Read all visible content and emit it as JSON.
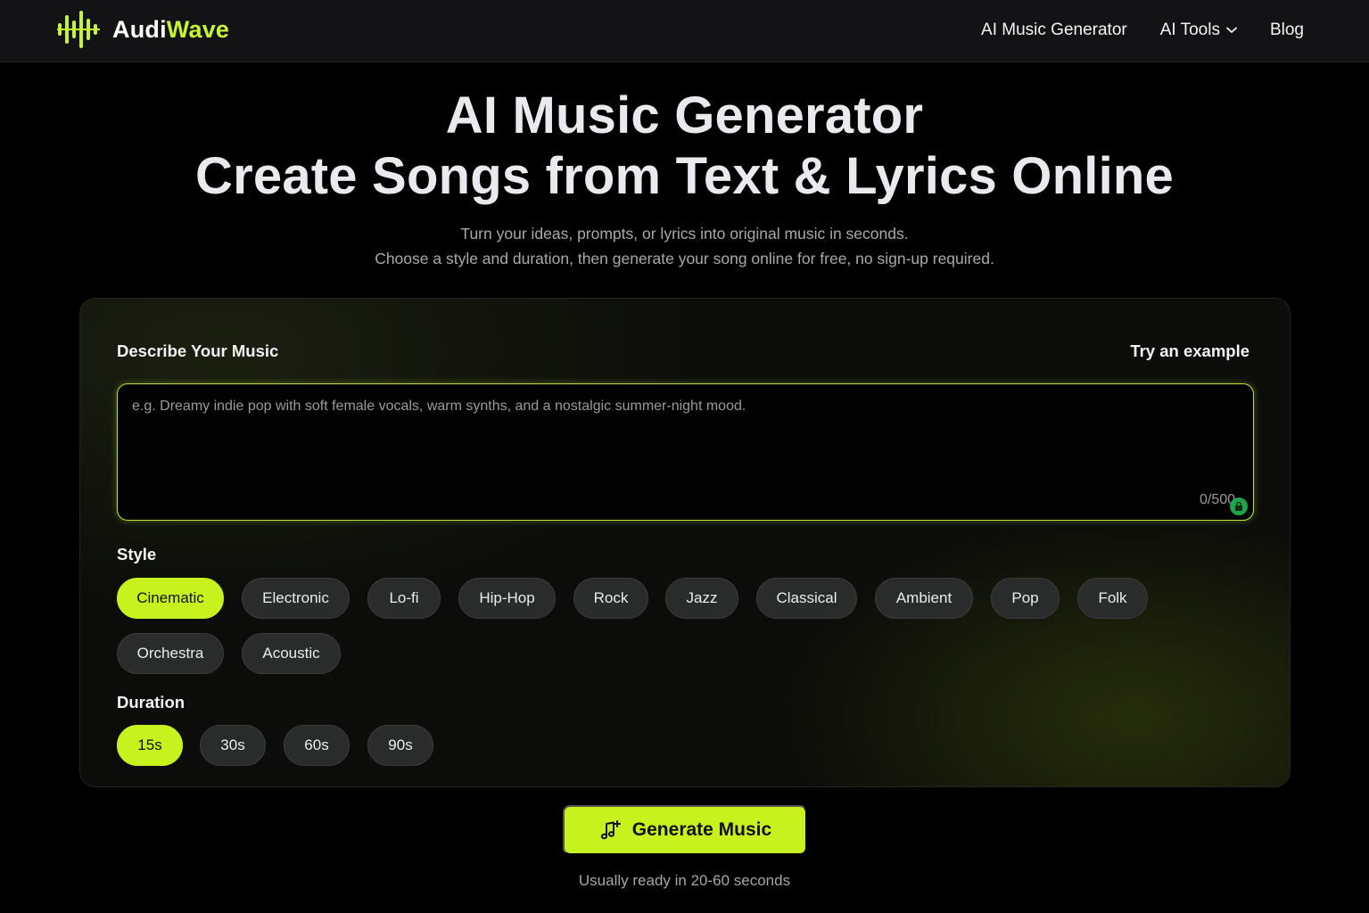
{
  "header": {
    "brand_part1": "Audi",
    "brand_part2": "Wave",
    "nav": [
      {
        "label": "AI Music Generator"
      },
      {
        "label": "AI Tools"
      },
      {
        "label": "Blog"
      }
    ]
  },
  "hero": {
    "title_line1": "AI Music Generator",
    "title_line2": "Create Songs from Text & Lyrics Online",
    "subtitle_line1": "Turn your ideas, prompts, or lyrics into original music in seconds.",
    "subtitle_line2": "Choose a style and duration, then generate your song online for free, no sign-up required."
  },
  "form": {
    "describe_label": "Describe Your Music",
    "try_example": "Try an example",
    "prompt_value": "",
    "prompt_placeholder": "e.g. Dreamy indie pop with soft female vocals, warm synths, and a nostalgic summer-night mood.",
    "counter": "0/500",
    "style_label": "Style",
    "styles": [
      "Cinematic",
      "Electronic",
      "Lo-fi",
      "Hip-Hop",
      "Rock",
      "Jazz",
      "Classical",
      "Ambient",
      "Pop",
      "Folk",
      "Orchestra",
      "Acoustic"
    ],
    "selected_style": "Cinematic",
    "duration_label": "Duration",
    "durations": [
      "15s",
      "30s",
      "60s",
      "90s"
    ],
    "selected_duration": "15s"
  },
  "generate": {
    "label": "Generate Music",
    "note": "Usually ready in 20-60 seconds"
  },
  "colors": {
    "accent": "#c8f21e",
    "brand_accent": "#c6f432",
    "badge_green": "#1ea44a",
    "chip_bg": "#2a2b2b",
    "background": "#000000"
  },
  "icons": {
    "logo": "soundwave-icon",
    "nav_dropdown": "chevron-down-icon",
    "counter_badge": "lock-icon",
    "generate": "music-note-plus-icon"
  }
}
